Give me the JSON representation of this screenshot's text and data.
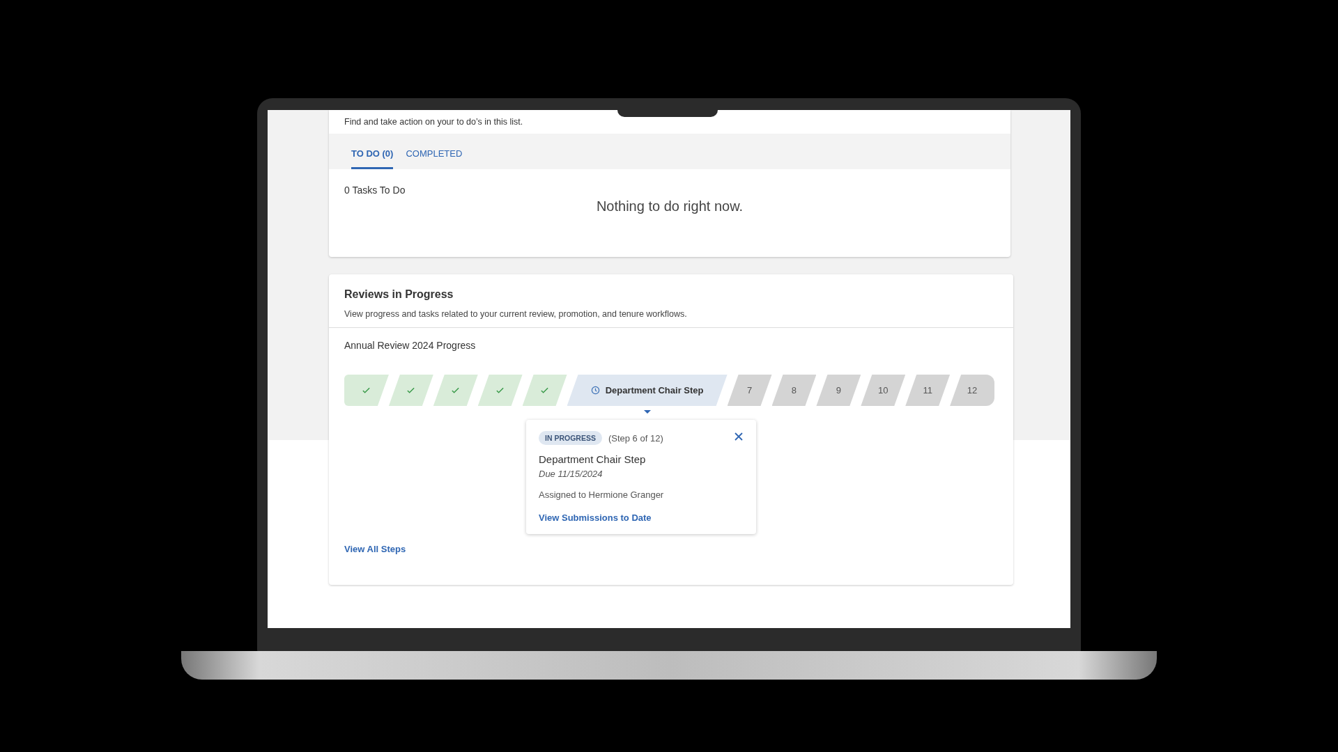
{
  "tasks": {
    "subtitle": "Find and take action on your to do’s in this list.",
    "tabs": [
      {
        "label": "TO DO (0)",
        "selected": true
      },
      {
        "label": "COMPLETED",
        "selected": false
      }
    ],
    "count": "0 Tasks To Do",
    "empty_message": "Nothing to do right now."
  },
  "reviews": {
    "title": "Reviews in Progress",
    "description": "View progress and tasks related to your current review, promotion, and tenure workflows.",
    "progress_title": "Annual Review 2024 Progress",
    "steps": [
      {
        "kind": "done"
      },
      {
        "kind": "done"
      },
      {
        "kind": "done"
      },
      {
        "kind": "done"
      },
      {
        "kind": "done"
      },
      {
        "kind": "current",
        "label": "Department Chair Step"
      },
      {
        "kind": "pending",
        "label": "7"
      },
      {
        "kind": "pending",
        "label": "8"
      },
      {
        "kind": "pending",
        "label": "9"
      },
      {
        "kind": "pending",
        "label": "10"
      },
      {
        "kind": "pending",
        "label": "11"
      },
      {
        "kind": "pending",
        "label": "12"
      }
    ],
    "popover": {
      "status": "IN PROGRESS",
      "step_of": "(Step 6 of 12)",
      "name": "Department Chair Step",
      "due": "Due 11/15/2024",
      "assigned": "Assigned to Hermione Granger",
      "link": "View Submissions to Date"
    },
    "view_all": "View All Steps"
  }
}
